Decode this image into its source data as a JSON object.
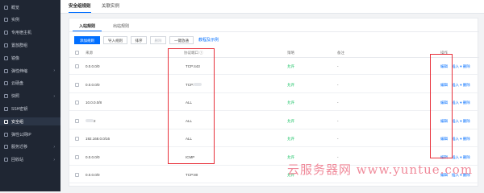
{
  "sidebar": {
    "items": [
      {
        "label": "概览",
        "active": false,
        "chevron": false
      },
      {
        "label": "实例",
        "active": false,
        "chevron": false
      },
      {
        "label": "专用宿主机",
        "active": false,
        "chevron": false
      },
      {
        "label": "置放群组",
        "active": false,
        "chevron": false
      },
      {
        "label": "镜像",
        "active": false,
        "chevron": false
      },
      {
        "label": "弹性伸缩",
        "active": false,
        "chevron": true
      },
      {
        "label": "云硬盘",
        "active": false,
        "chevron": false
      },
      {
        "label": "快照",
        "active": false,
        "chevron": true
      },
      {
        "label": "SSH密钥",
        "active": false,
        "chevron": false
      },
      {
        "label": "安全组",
        "active": true,
        "chevron": false
      },
      {
        "label": "弹性公网IP",
        "active": false,
        "chevron": false
      },
      {
        "label": "服务迁移",
        "active": false,
        "chevron": true
      },
      {
        "label": "回收站",
        "active": false,
        "chevron": true
      }
    ]
  },
  "header": {
    "tabs": [
      {
        "label": "安全组规则",
        "active": true
      },
      {
        "label": "关联实例",
        "active": false
      }
    ]
  },
  "rules": {
    "subtabs": [
      {
        "label": "入站规则",
        "active": true
      },
      {
        "label": "出站规则",
        "active": false
      }
    ],
    "toolbar": {
      "add": "添加规则",
      "import": "导入规则",
      "sort": "排序",
      "delete": "删除",
      "allow_all": "一键放通",
      "tutorial": "教程及示例"
    },
    "columns": {
      "source": "来源",
      "protocol": "协议端口",
      "policy": "策略",
      "note": "备注",
      "action": "操作"
    },
    "rows": [
      {
        "source": "0.0.0.0/0",
        "protocol": "TCP:443",
        "policy": "允许",
        "note": "-",
        "actions": [
          "编辑",
          "插入",
          "删除"
        ]
      },
      {
        "source": "0.0.0.0/0",
        "protocol": "TCP:",
        "policy": "允许",
        "note": "-",
        "actions": [
          "编辑",
          "插入",
          "删除"
        ]
      },
      {
        "source": "10.0.0.0/8",
        "protocol": "ALL",
        "policy": "允许",
        "note": "-",
        "actions": [
          "编辑",
          "插入",
          "删除"
        ]
      },
      {
        "source": "2",
        "protocol": "ALL",
        "policy": "允许",
        "note": "-",
        "actions": [
          "编辑",
          "插入",
          "删除"
        ]
      },
      {
        "source": "192.168.0.0/16",
        "protocol": "ALL",
        "policy": "允许",
        "note": "-",
        "actions": [
          "编辑",
          "插入",
          "删除"
        ]
      },
      {
        "source": "0.0.0.0/0",
        "protocol": "ICMP",
        "policy": "允许",
        "note": "-",
        "actions": [
          "编辑",
          "插入",
          "删除"
        ]
      },
      {
        "source": "0.0.0.0/0",
        "protocol": "TCP:80",
        "policy": "允许",
        "note": "-",
        "actions": [
          "编辑",
          "插入",
          "删除"
        ]
      }
    ]
  },
  "watermark": "云服务器网 www.yuntue.com",
  "colors": {
    "accent": "#006eff",
    "allow": "#0abf5b",
    "highlight": "#e8303a",
    "sidebar": "#1f2633"
  }
}
